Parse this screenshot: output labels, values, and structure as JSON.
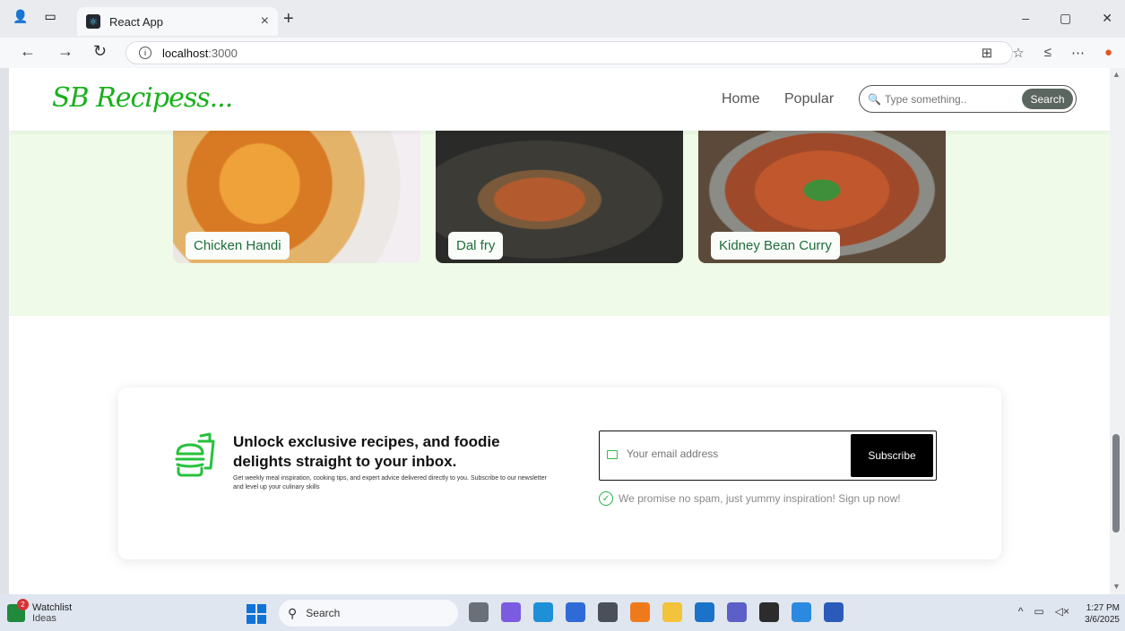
{
  "browser": {
    "tab_title": "React App",
    "tab_close": "×",
    "new_tab": "+",
    "url_host": "localhost",
    "url_port": ":3000",
    "minimize": "–",
    "restore": "▢",
    "close": "✕"
  },
  "header": {
    "logo": "SB Recipess...",
    "nav": [
      "Home",
      "Popular"
    ],
    "search_placeholder": "Type something..",
    "search_button": "Search"
  },
  "cards": [
    {
      "label": "Chicken Handi"
    },
    {
      "label": "Dal fry"
    },
    {
      "label": "Kidney Bean Curry"
    }
  ],
  "newsletter": {
    "heading": "Unlock exclusive recipes, and foodie delights straight to your inbox.",
    "subtext": "Get weekly meal inspiration, cooking tips, and expert advice delivered directly to you. Subscribe to our newsletter and level up your culinary skills",
    "email_placeholder": "Your email address",
    "subscribe_button": "Subscribe",
    "promise": "We promise no spam, just yummy inspiration! Sign up now!"
  },
  "taskbar": {
    "watchlist_title": "Watchlist",
    "watchlist_sub": "Ideas",
    "watchlist_badge": "2",
    "search_label": "Search",
    "time": "1:27 PM",
    "date": "3/6/2025"
  },
  "colors": {
    "brand_green": "#18b11a",
    "band_green": "#effbe8"
  }
}
